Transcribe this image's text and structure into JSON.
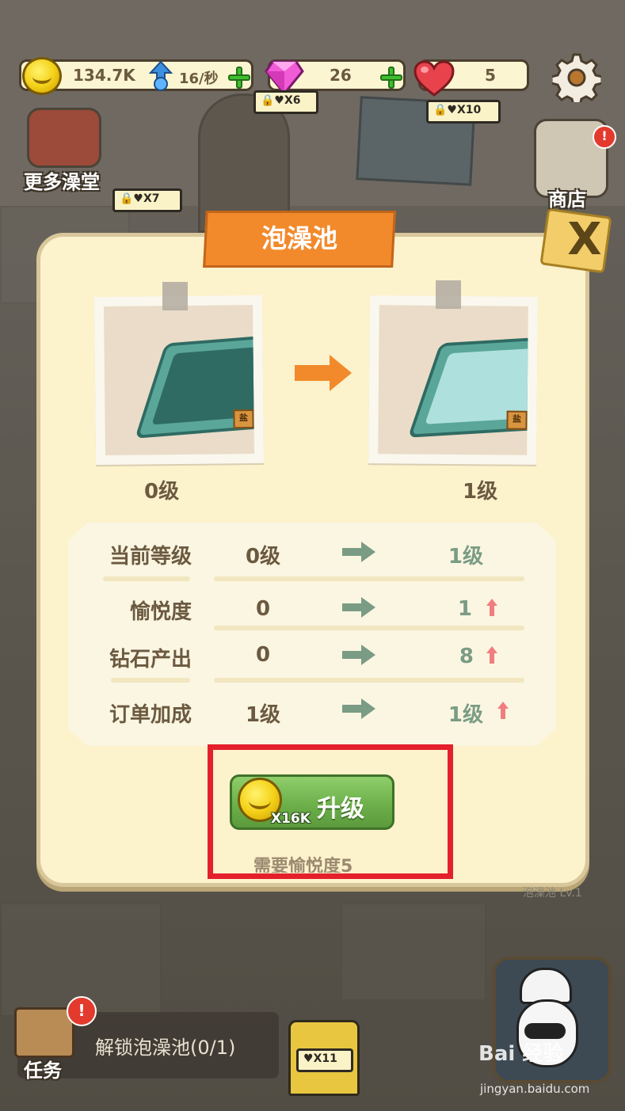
{
  "resources": {
    "coins": "134.7K",
    "rate": "16/秒",
    "gems": "26",
    "hearts": "5"
  },
  "lock_tags": {
    "door": "X6",
    "poster": "X10",
    "left": "X7",
    "bottom": "X11"
  },
  "side_buttons": {
    "more_baths": "更多澡堂",
    "shop": "商店",
    "badge": "!"
  },
  "dialog": {
    "title": "泡澡池",
    "close": "X",
    "current_level_label": "0级",
    "next_level_label": "1级",
    "sign_char": "盐",
    "stats": [
      {
        "label": "当前等级",
        "current": "0级",
        "next": "1级",
        "up": false
      },
      {
        "label": "愉悦度",
        "current": "0",
        "next": "1",
        "up": true
      },
      {
        "label": "钻石产出",
        "current": "0",
        "next": "8",
        "up": true
      },
      {
        "label": "订单加成",
        "current": "1级",
        "next": "1级",
        "up": true
      }
    ],
    "upgrade_label": "升级",
    "upgrade_cost": "X16K",
    "requirement": "需要愉悦度5"
  },
  "bottom": {
    "task_label": "任务",
    "task_text": "解锁泡澡池(0/1)",
    "badge": "!",
    "building_label": "泡澡池 Lv.1",
    "watermark": "Bai 经验",
    "watermark_url": "jingyan.baidu.com"
  },
  "colors": {
    "title_orange": "#f28a2c",
    "dialog_bg": "#fcf2cc",
    "button_green": "#6db04a",
    "highlight_red": "#e3202b",
    "next_value_green": "#7a9c84",
    "up_arrow_pink": "#f07e80"
  }
}
